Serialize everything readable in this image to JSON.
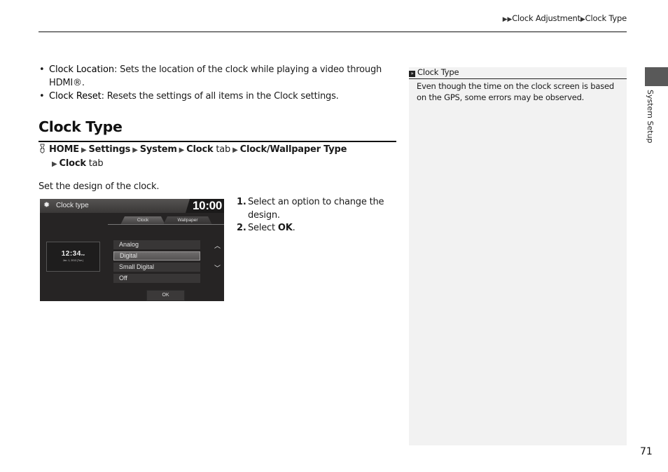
{
  "header": {
    "breadcrumb": [
      "Clock Adjustment",
      "Clock Type"
    ],
    "arrow": "▶"
  },
  "bullets": [
    {
      "term": "Clock Location",
      "text": ": Sets the location of the clock while playing a video through HDMI®."
    },
    {
      "term": "Clock Reset",
      "text": ": Resets the settings of all items in the Clock settings."
    }
  ],
  "section": {
    "title": "Clock Type",
    "nav_path": {
      "line1": [
        {
          "bold": "HOME"
        },
        {
          "bold": "Settings"
        },
        {
          "bold": "System"
        },
        {
          "bold": "Clock",
          "plain": " tab"
        },
        {
          "bold": "Clock/Wallpaper Type"
        }
      ],
      "line2": {
        "bold": "Clock",
        "plain": " tab"
      }
    },
    "description": "Set the design of the clock."
  },
  "screen": {
    "title": "Clock type",
    "time": "10:00",
    "tabs": [
      "Clock",
      "Wallpaper"
    ],
    "active_tab": "Clock",
    "preview_time": "12:34",
    "preview_ampm": "PM",
    "preview_date": "Jan. 1, 2013 (Tue.)",
    "options": [
      "Analog",
      "Digital",
      "Small Digital",
      "Off"
    ],
    "selected_option": "Digital",
    "ok_label": "OK"
  },
  "steps": [
    {
      "num": "1.",
      "text": "Select an option to change the design."
    },
    {
      "num": "2.",
      "text_before": "Select ",
      "bold": "OK",
      "text_after": "."
    }
  ],
  "note": {
    "title": "Clock Type",
    "body": "Even though the time on the clock screen is based on the GPS, some errors may be observed."
  },
  "side_label": "System Setup",
  "page_number": "71"
}
